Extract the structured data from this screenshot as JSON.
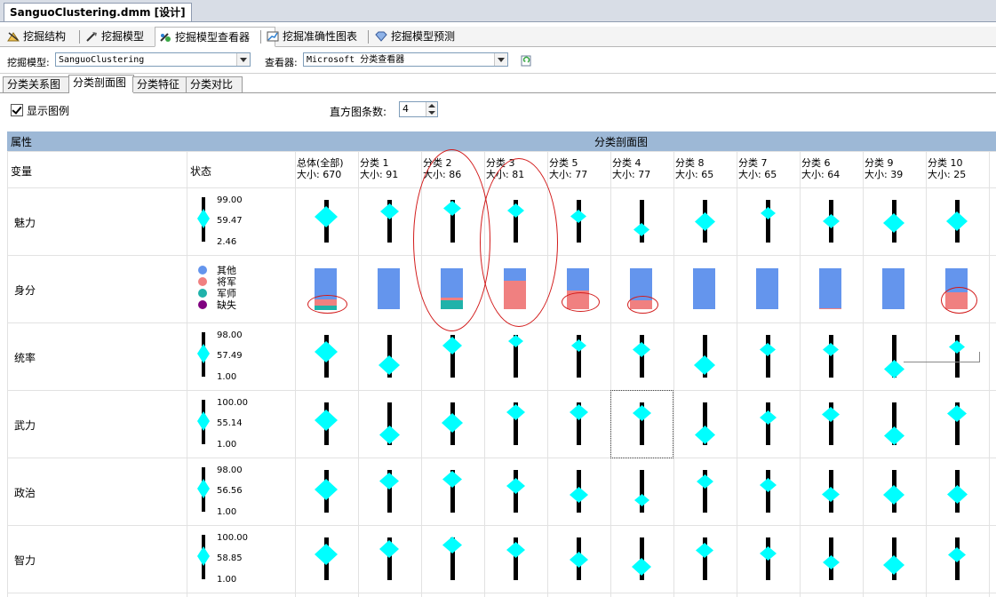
{
  "document_tab": "SanguoClustering.dmm [设计]",
  "menu_tabs": [
    {
      "label": "挖掘结构",
      "icon": "mining-structure-icon"
    },
    {
      "label": "挖掘模型",
      "icon": "mining-model-icon"
    },
    {
      "label": "挖掘模型查看器",
      "icon": "mining-model-viewer-icon",
      "active": true
    },
    {
      "label": "挖掘准确性图表",
      "icon": "accuracy-chart-icon"
    },
    {
      "label": "挖掘模型预测",
      "icon": "prediction-icon"
    }
  ],
  "toolbar": {
    "model_label": "挖掘模型:",
    "model_value": "SanguoClustering",
    "viewer_label": "查看器:",
    "viewer_value": "Microsoft 分类查看器"
  },
  "sub_tabs": [
    {
      "label": "分类关系图"
    },
    {
      "label": "分类剖面图",
      "active": true
    },
    {
      "label": "分类特征"
    },
    {
      "label": "分类对比"
    }
  ],
  "options": {
    "show_legend_label": "显示图例",
    "hist_bars_label": "直方图条数:",
    "hist_bars_value": "4"
  },
  "grid": {
    "attributes_header": "属性",
    "profiles_header": "分类剖面图",
    "variable_header": "变量",
    "state_header": "状态",
    "columns": [
      {
        "name": "总体(全部)",
        "size": "大小: 670"
      },
      {
        "name": "分类 1",
        "size": "大小: 91"
      },
      {
        "name": "分类 2",
        "size": "大小: 86"
      },
      {
        "name": "分类 3",
        "size": "大小: 81"
      },
      {
        "name": "分类 5",
        "size": "大小: 77"
      },
      {
        "name": "分类 4",
        "size": "大小: 77"
      },
      {
        "name": "分类 8",
        "size": "大小: 65"
      },
      {
        "name": "分类 7",
        "size": "大小: 65"
      },
      {
        "name": "分类 6",
        "size": "大小: 64"
      },
      {
        "name": "分类 9",
        "size": "大小: 39"
      },
      {
        "name": "分类 10",
        "size": "大小: 25"
      }
    ],
    "rows": [
      {
        "name": "魅力",
        "type": "continuous",
        "max": "99.00",
        "mean": "59.47",
        "min": "2.46",
        "pos": [
          0.4,
          0.28,
          0.2,
          0.25,
          0.38,
          0.7,
          0.5,
          0.32,
          0.5,
          0.55,
          0.5
        ],
        "size": [
          1.0,
          0.7,
          0.65,
          0.6,
          0.55,
          0.55,
          0.85,
          0.5,
          0.6,
          0.9,
          0.9
        ]
      },
      {
        "name": "身分",
        "type": "discrete",
        "states": [
          {
            "label": "其他",
            "color": "#6495ed"
          },
          {
            "label": "将军",
            "color": "#f08080"
          },
          {
            "label": "军师",
            "color": "#20b2aa"
          },
          {
            "label": "缺失",
            "color": "#800080"
          }
        ],
        "hist": [
          [
            0.75,
            0.15,
            0.1
          ],
          [
            1.0,
            0,
            0
          ],
          [
            0.72,
            0.06,
            0.22
          ],
          [
            0.3,
            0.7,
            0
          ],
          [
            0.55,
            0.45,
            0
          ],
          [
            0.78,
            0.22,
            0
          ],
          [
            1.0,
            0,
            0
          ],
          [
            1.0,
            0,
            0
          ],
          [
            0.97,
            0.03,
            0
          ],
          [
            1.0,
            0,
            0
          ],
          [
            0.58,
            0.42,
            0
          ]
        ]
      },
      {
        "name": "统率",
        "type": "continuous",
        "max": "98.00",
        "mean": "57.49",
        "min": "1.00",
        "pos": [
          0.4,
          0.7,
          0.25,
          0.15,
          0.25,
          0.35,
          0.7,
          0.35,
          0.35,
          0.8,
          0.28
        ],
        "size": [
          1.0,
          0.9,
          0.8,
          0.5,
          0.5,
          0.65,
          0.9,
          0.55,
          0.55,
          0.85,
          0.55
        ]
      },
      {
        "name": "武力",
        "type": "continuous",
        "max": "100.00",
        "mean": "55.14",
        "min": "1.00",
        "pos": [
          0.42,
          0.75,
          0.47,
          0.22,
          0.22,
          0.25,
          0.75,
          0.35,
          0.28,
          0.78,
          0.25
        ],
        "size": [
          1.0,
          0.85,
          0.9,
          0.7,
          0.7,
          0.7,
          0.85,
          0.6,
          0.65,
          0.85,
          0.75
        ]
      },
      {
        "name": "政治",
        "type": "continuous",
        "max": "98.00",
        "mean": "56.56",
        "min": "1.00",
        "pos": [
          0.45,
          0.25,
          0.22,
          0.38,
          0.58,
          0.7,
          0.28,
          0.35,
          0.58,
          0.58,
          0.58
        ],
        "size": [
          1.0,
          0.75,
          0.75,
          0.7,
          0.7,
          0.5,
          0.6,
          0.6,
          0.65,
          0.9,
          0.85
        ]
      },
      {
        "name": "智力",
        "type": "continuous",
        "max": "100.00",
        "mean": "58.85",
        "min": "1.00",
        "pos": [
          0.4,
          0.28,
          0.18,
          0.3,
          0.52,
          0.68,
          0.3,
          0.38,
          0.58,
          0.65,
          0.4
        ],
        "size": [
          1.0,
          0.8,
          0.75,
          0.7,
          0.7,
          0.8,
          0.65,
          0.6,
          0.6,
          0.9,
          0.65
        ]
      }
    ]
  }
}
